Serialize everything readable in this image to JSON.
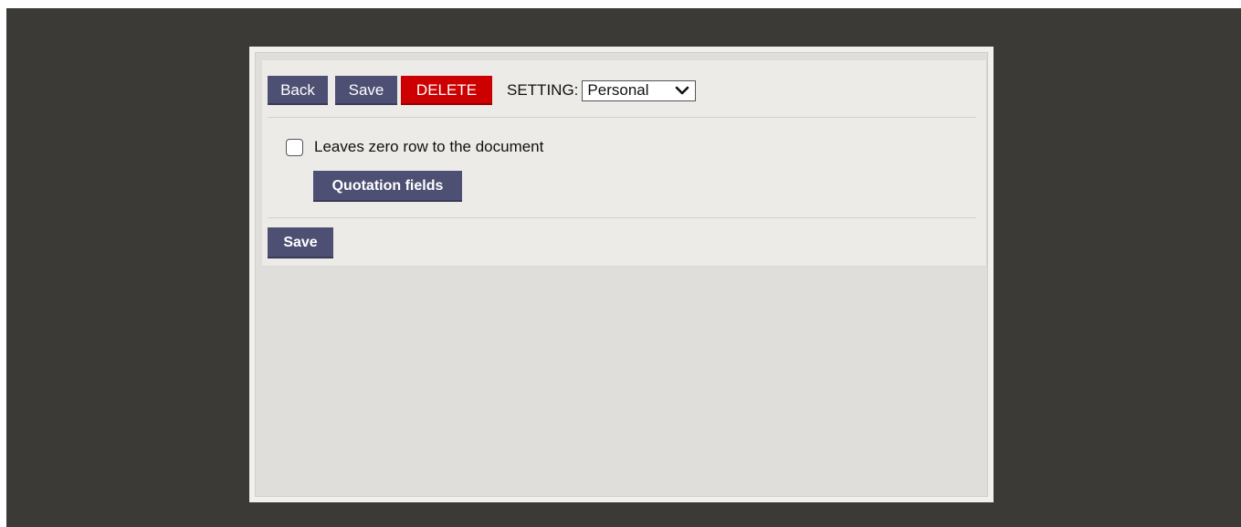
{
  "toolbar": {
    "back_label": "Back",
    "save_label": "Save",
    "delete_label": "DELETE",
    "setting_label": "SETTING:",
    "setting_selected": "Personal"
  },
  "options": {
    "zero_row_label": "Leaves zero row to the document",
    "zero_row_checked": false,
    "quotation_fields_label": "Quotation fields"
  },
  "footer": {
    "save_label": "Save"
  },
  "colors": {
    "backdrop": "#3c3a36",
    "button_primary": "#4d4f73",
    "button_danger": "#cc0000",
    "panel": "#ecebe8"
  },
  "icons": {
    "select_arrow": "chevron-down-icon"
  }
}
